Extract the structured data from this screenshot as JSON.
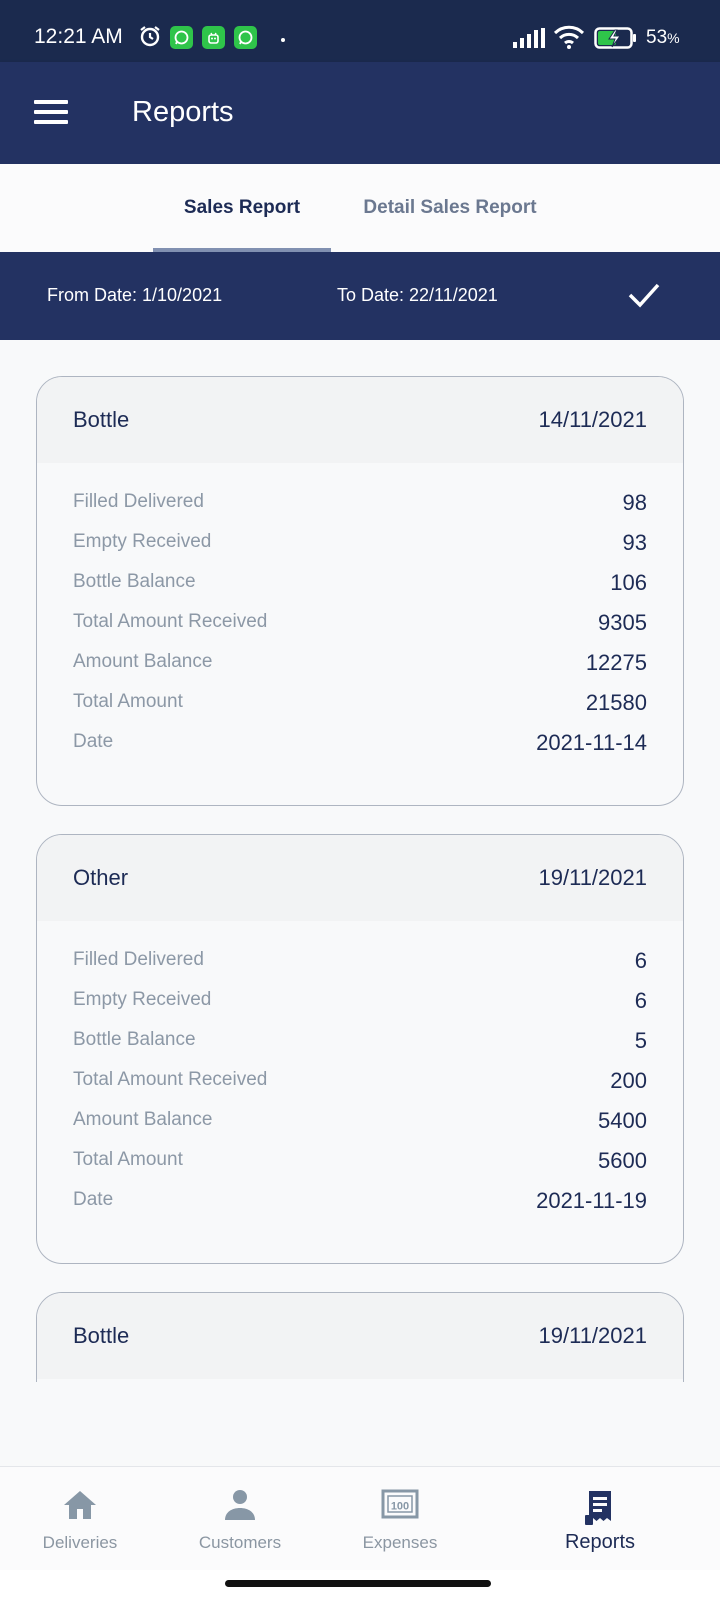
{
  "status_bar": {
    "time": "12:21 AM",
    "battery_percent": "53",
    "battery_suffix": "%",
    "notification_icons": [
      "whatsapp-icon",
      "android-icon",
      "whatsapp-icon"
    ],
    "accent": "#2fc44a"
  },
  "app_bar": {
    "title": "Reports",
    "background": "#233262"
  },
  "tabs": [
    {
      "label": "Sales Report",
      "selected": true
    },
    {
      "label": "Detail Sales Report",
      "selected": false
    }
  ],
  "date_filter": {
    "from": "From Date: 1/10/2021",
    "to": "To Date: 22/11/2021"
  },
  "field_labels": {
    "filled_delivered": "Filled Delivered",
    "empty_received": "Empty Received",
    "bottle_balance": "Bottle Balance",
    "total_amount_received": "Total Amount Received",
    "amount_balance": "Amount Balance",
    "total_amount": "Total Amount",
    "date": "Date"
  },
  "reports": [
    {
      "type": "Bottle",
      "header_date": "14/11/2021",
      "filled_delivered": "98",
      "empty_received": "93",
      "bottle_balance": "106",
      "total_amount_received": "9305",
      "amount_balance": "12275",
      "total_amount": "21580",
      "date": "2021-11-14"
    },
    {
      "type": "Other",
      "header_date": "19/11/2021",
      "filled_delivered": "6",
      "empty_received": "6",
      "bottle_balance": "5",
      "total_amount_received": "200",
      "amount_balance": "5400",
      "total_amount": "5600",
      "date": "2021-11-19"
    },
    {
      "type": "Bottle",
      "header_date": "19/11/2021"
    }
  ],
  "bottom_nav": [
    {
      "label": "Deliveries",
      "icon": "home-icon",
      "active": false
    },
    {
      "label": "Customers",
      "icon": "person-icon",
      "active": false
    },
    {
      "label": "Expenses",
      "icon": "money-icon",
      "active": false
    },
    {
      "label": "Reports",
      "icon": "receipt-icon",
      "active": true
    }
  ]
}
